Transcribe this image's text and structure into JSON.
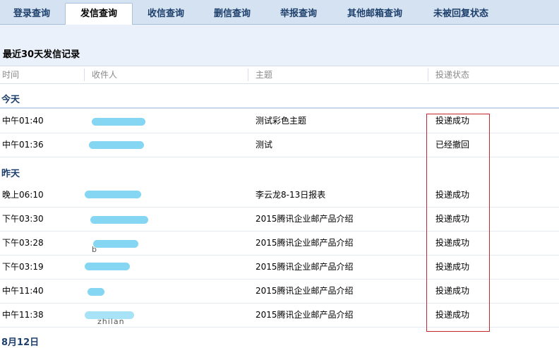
{
  "tabs": [
    {
      "label": "登录查询"
    },
    {
      "label": "发信查询",
      "active": true
    },
    {
      "label": "收信查询"
    },
    {
      "label": "删信查询"
    },
    {
      "label": "举报查询"
    },
    {
      "label": "其他邮箱查询"
    },
    {
      "label": "未被回复状态"
    }
  ],
  "section_title": "最近30天发信记录",
  "columns": {
    "time": "时间",
    "recipient": "收件人",
    "subject": "主题",
    "status": "投递状态"
  },
  "groups": {
    "today": "今天",
    "yesterday": "昨天",
    "next": "8月12日"
  },
  "rows": [
    {
      "time": "中午01:40",
      "recipient_fragment": "",
      "subject": "测试彩色主题",
      "status": "投递成功"
    },
    {
      "time": "中午01:36",
      "recipient_fragment": "",
      "subject": "测试",
      "status": "已经撤回"
    },
    {
      "time": "晚上06:10",
      "recipient_fragment": "",
      "subject": "李云龙8-13日报表",
      "status": "投递成功"
    },
    {
      "time": "下午03:30",
      "recipient_fragment": "",
      "subject": "2015腾讯企业邮产品介绍",
      "status": "投递成功"
    },
    {
      "time": "下午03:28",
      "recipient_fragment": "b",
      "subject": "2015腾讯企业邮产品介绍",
      "status": "投递成功"
    },
    {
      "time": "下午03:19",
      "recipient_fragment": "",
      "subject": "2015腾讯企业邮产品介绍",
      "status": "投递成功"
    },
    {
      "time": "中午11:40",
      "recipient_fragment": "",
      "subject": "2015腾讯企业邮产品介绍",
      "status": "投递成功"
    },
    {
      "time": "中午11:38",
      "recipient_fragment": "zhilan",
      "subject": "2015腾讯企业邮产品介绍",
      "status": "投递成功"
    }
  ],
  "colors": {
    "tab_text": "#1d3f6b",
    "highlight_border": "#c1272d",
    "redaction": "#6ecff0"
  }
}
